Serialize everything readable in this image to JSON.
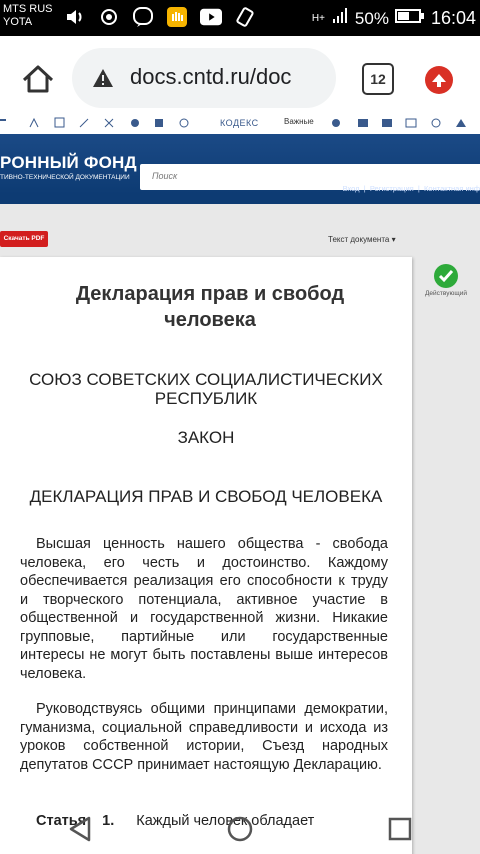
{
  "status_bar": {
    "carrier_1": "MTS RUS",
    "carrier_2": "YOTA",
    "network": "H+",
    "battery_pct": "50%",
    "time": "16:04"
  },
  "browser": {
    "url": "docs.cntd.ru/doc",
    "tab_count": "12"
  },
  "site": {
    "title": "РОННЫЙ ФОНД",
    "subtitle": "ТИВНО-ТЕХНИЧЕСКОЙ ДОКУМЕНТАЦИИ",
    "kodeks": "КОДЕКС",
    "important": "Важные",
    "search_placeholder": "Поиск",
    "nav_login": "Вход",
    "nav_register": "Регистрация",
    "nav_contact": "Контактная инф"
  },
  "doc": {
    "pdf_button": "Скачать PDF",
    "text_dropdown": "Текст документа ▾",
    "status": "Действующий",
    "title": "Декларация прав и свобод человека",
    "header_ussr": "СОЮЗ СОВЕТСКИХ СОЦИАЛИСТИЧЕСКИХ РЕСПУБЛИК",
    "header_law": "ЗАКОН",
    "header_decl": "ДЕКЛАРАЦИЯ ПРАВ И СВОБОД ЧЕЛОВЕКА",
    "para1": "Высшая ценность нашего общества - свобода человека, его честь и достоинство. Каждому обеспечивается реализация его способности к труду и творческого потенциала, активное участие в общественной и государственной жизни. Никакие групповые, партийные или государственные интересы не могут быть поставлены выше интересов человека.",
    "para2": "Руководствуясь общими принципами демократии, гуманизма, социальной справедливости и исхода из уроков собственной истории, Съезд народных депутатов СССР принимает настоящую Декларацию.",
    "article_label": "Статья",
    "article_num": "1.",
    "article_text": "Каждый человек обладает"
  }
}
